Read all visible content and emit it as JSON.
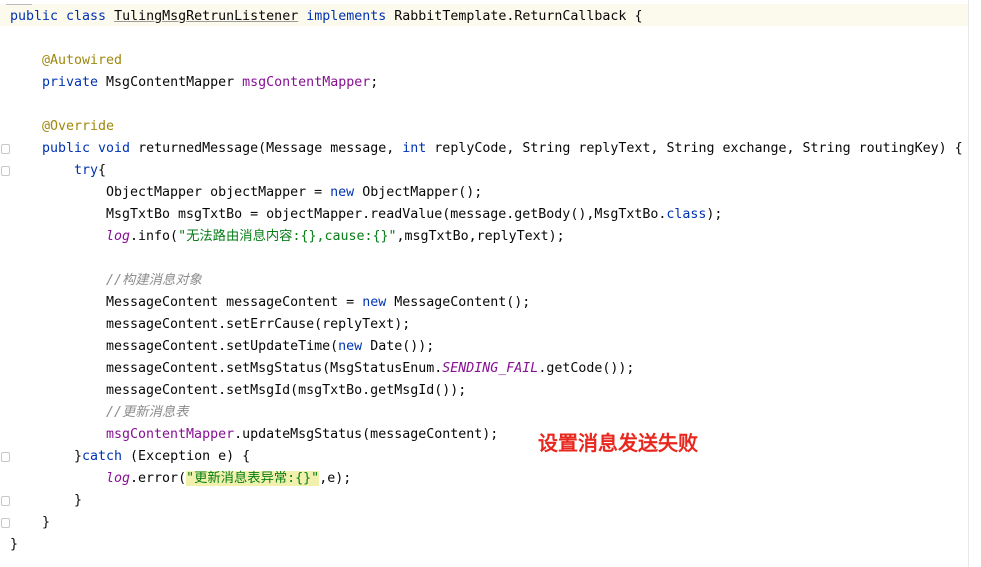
{
  "editor": {
    "lines": {
      "l1": {
        "kw1": "public class ",
        "cls": "TulingMsgRetrunListener",
        "kw2": " implements ",
        "rest": "RabbitTemplate.ReturnCallback {"
      },
      "l2": {
        "ann": "@Autowired"
      },
      "l3": {
        "kw": "private ",
        "type": "MsgContentMapper ",
        "field": "msgContentMapper",
        "end": ";"
      },
      "l4": {
        "ann": "@Override"
      },
      "l5": {
        "kw1": "public void ",
        "name": "returnedMessage(Message message, ",
        "kw2": "int",
        "rest": " replyCode, String replyText, String exchange, String routingKey) {"
      },
      "l6": {
        "kw": "try",
        "end": "{"
      },
      "l7": {
        "a": "ObjectMapper objectMapper = ",
        "kw": "new",
        "b": " ObjectMapper();"
      },
      "l8": {
        "a": "MsgTxtBo msgTxtBo = objectMapper.readValue(message.getBody(),MsgTxtBo.",
        "kw": "class",
        "b": ");"
      },
      "l9": {
        "st": "log",
        "a": ".info(",
        "str": "\"无法路由消息内容:{},cause:{}\"",
        "b": ",msgTxtBo,replyText);"
      },
      "l10": {
        "cmt": "//构建消息对象"
      },
      "l11": {
        "a": "MessageContent messageContent = ",
        "kw": "new",
        "b": " MessageContent();"
      },
      "l12": {
        "a": "messageContent.setErrCause(replyText);"
      },
      "l13": {
        "a": "messageContent.setUpdateTime(",
        "kw": "new",
        "b": " Date());"
      },
      "l14": {
        "a": "messageContent.setMsgStatus(MsgStatusEnum.",
        "st": "SENDING_FAIL",
        "b": ".getCode());"
      },
      "l15": {
        "a": "messageContent.setMsgId(msgTxtBo.getMsgId());"
      },
      "l16": {
        "cmt": "//更新消息表"
      },
      "l17": {
        "field": "msgContentMapper",
        "a": ".updateMsgStatus(messageContent);"
      },
      "l18": {
        "a": "}",
        "kw": "catch",
        "b": " (Exception e) {"
      },
      "l19": {
        "st": "log",
        "a": ".error(",
        "str": "\"更新消息表异常:{}\"",
        "b": ",e);"
      },
      "l20": {
        "a": "}"
      },
      "l21": {
        "a": "}"
      },
      "l22": {
        "a": "}"
      }
    }
  },
  "annotation": {
    "text": "设置消息发送失败",
    "color": "#e8281f"
  }
}
